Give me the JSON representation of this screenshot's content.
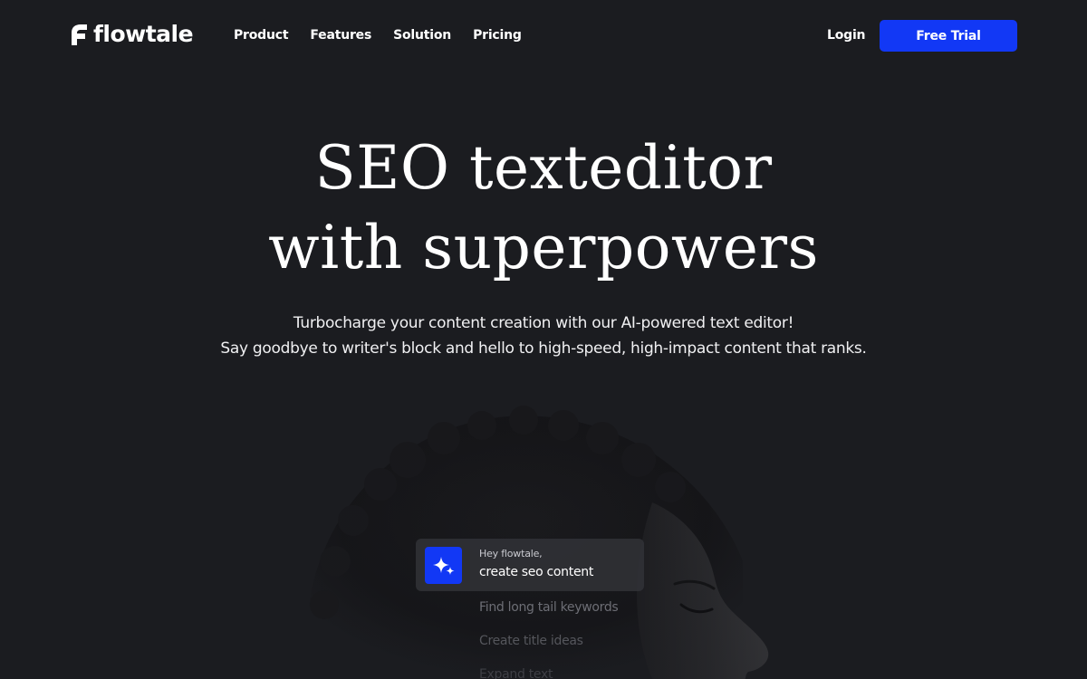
{
  "brand": {
    "name": "flowtale",
    "accent": "#1238f5",
    "background": "#1b1c20"
  },
  "nav": {
    "items": [
      "Product",
      "Features",
      "Solution",
      "Pricing"
    ],
    "login_label": "Login",
    "cta_label": "Free Trial"
  },
  "hero": {
    "title_line1": "SEO texteditor",
    "title_line2": "with superpowers",
    "subtitle_line1": "Turbocharge your content creation with our AI-powered text editor!",
    "subtitle_line2": "Say goodbye to writer's block and hello to high-speed, high-impact content that ranks."
  },
  "prompt": {
    "icon": "sparkle-icon",
    "greeting": "Hey flowtale,",
    "command": "create seo content",
    "suggestions": [
      "Find long tail keywords",
      "Create title ideas",
      "Expand text"
    ]
  }
}
